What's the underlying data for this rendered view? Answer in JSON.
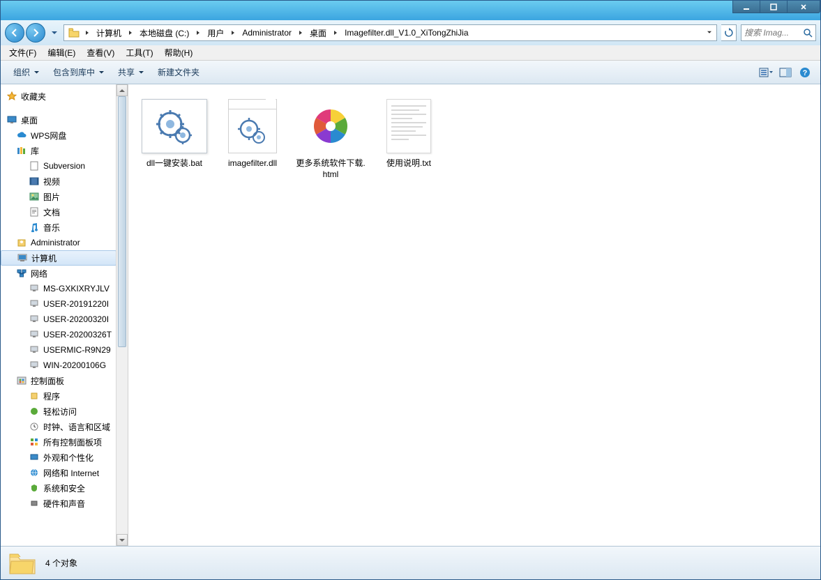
{
  "window": {
    "controls": {
      "min": "−",
      "max": "□",
      "close": "×"
    }
  },
  "breadcrumb": [
    "计算机",
    "本地磁盘 (C:)",
    "用户",
    "Administrator",
    "桌面",
    "Imagefilter.dll_V1.0_XiTongZhiJia"
  ],
  "search": {
    "placeholder": "搜索 Imag..."
  },
  "menubar": [
    "文件(F)",
    "编辑(E)",
    "查看(V)",
    "工具(T)",
    "帮助(H)"
  ],
  "toolbar": {
    "organize": "组织",
    "include": "包含到库中",
    "share": "共享",
    "newfolder": "新建文件夹"
  },
  "sidebar": {
    "favorites": "收藏夹",
    "desktop": "桌面",
    "wps": "WPS网盘",
    "libraries": "库",
    "lib_items": [
      "Subversion",
      "视频",
      "图片",
      "文档",
      "音乐"
    ],
    "admin": "Administrator",
    "computer": "计算机",
    "network": "网络",
    "net_items": [
      "MS-GXKIXRYJLV",
      "USER-20191220I",
      "USER-20200320I",
      "USER-20200326T",
      "USERMIC-R9N29",
      "WIN-20200106G"
    ],
    "control": "控制面板",
    "cp_items": [
      "程序",
      "轻松访问",
      "时钟、语言和区域",
      "所有控制面板项",
      "外观和个性化",
      "网络和 Internet",
      "系统和安全",
      "硬件和声音"
    ]
  },
  "files": [
    {
      "name": "dll一键安装.bat",
      "type": "bat"
    },
    {
      "name": "imagefilter.dll",
      "type": "dll"
    },
    {
      "name": "更多系统软件下载.html",
      "type": "html"
    },
    {
      "name": "使用说明.txt",
      "type": "txt"
    }
  ],
  "status": {
    "count": "4 个对象"
  }
}
